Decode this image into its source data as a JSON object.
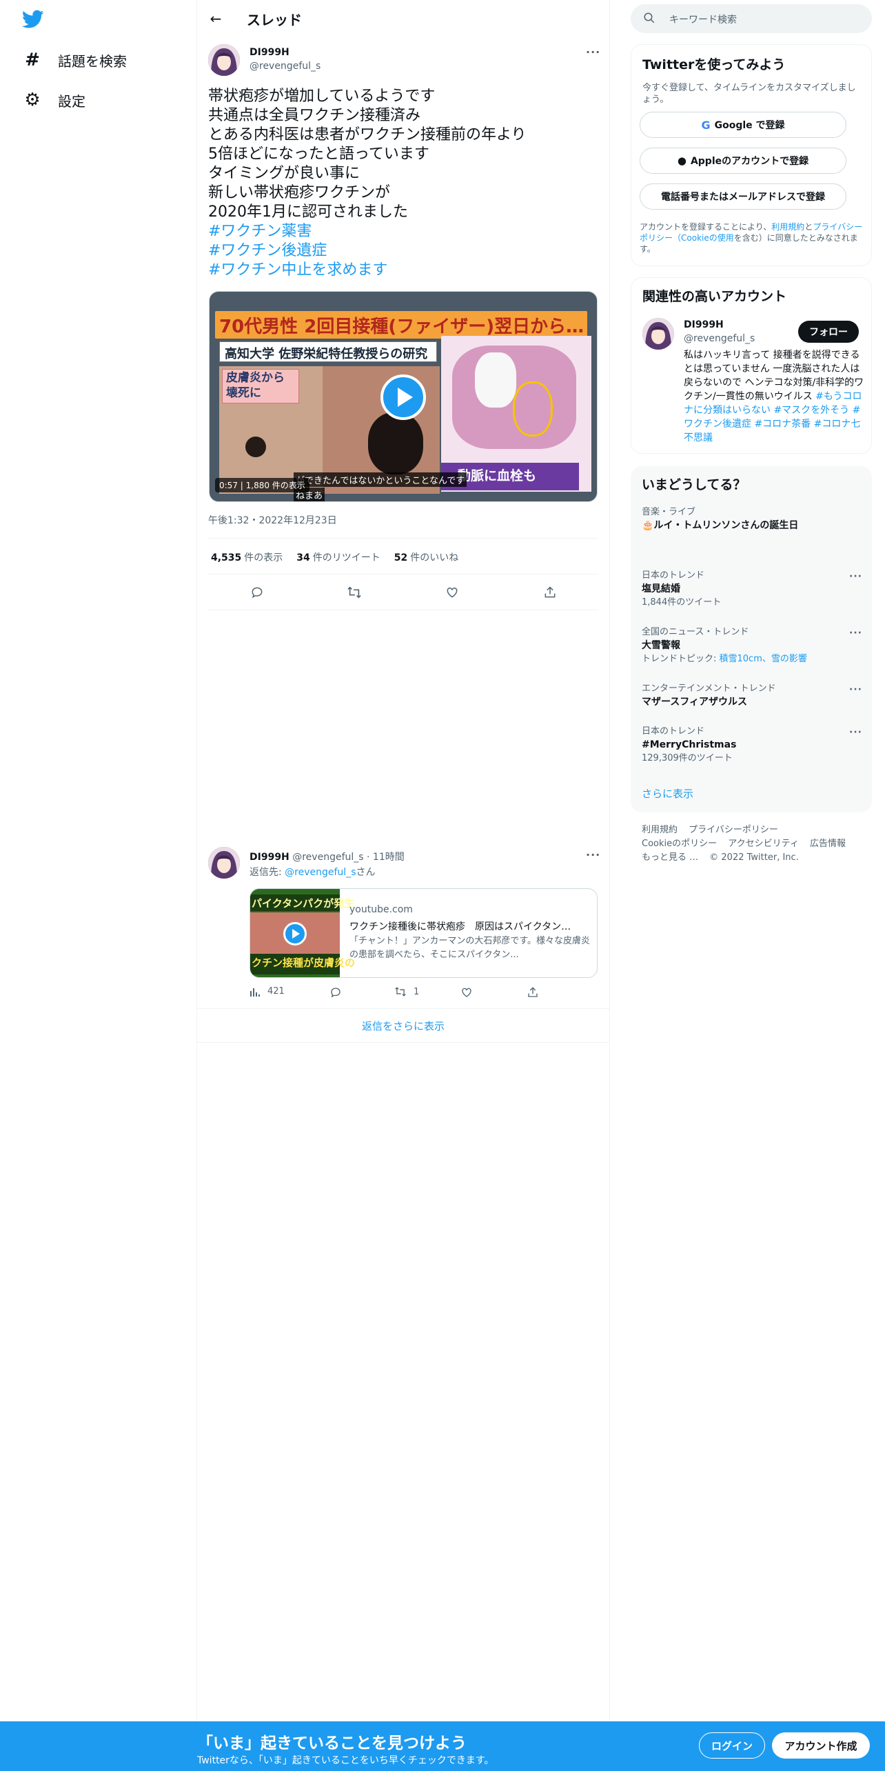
{
  "nav": {
    "logo": "twitter-bird",
    "items": [
      {
        "icon": "hashtag-icon",
        "glyph": "#",
        "label": "話題を検索"
      },
      {
        "icon": "gear-icon",
        "glyph": "⚙",
        "label": "設定"
      }
    ]
  },
  "header": {
    "title": "スレッド"
  },
  "tweet": {
    "author_name": "DI999H",
    "author_handle": "@revengeful_s",
    "text_lines": [
      "帯状疱疹が増加しているようです",
      "共通点は全員ワクチン接種済み",
      "とある内科医は患者がワクチン接種前の年より",
      "5倍ほどになったと語っています",
      "タイミングが良い事に",
      "新しい帯状疱疹ワクチンが",
      "2020年1月に認可されました"
    ],
    "hashtags": [
      "#ワクチン薬害",
      "#ワクチン後遺症",
      "#ワクチン中止を求めます"
    ],
    "media": {
      "banner": "70代男性 2回目接種(ファイザー)翌日から…",
      "subtitle": "高知大学 佐野栄紀特任教授らの研究",
      "callout": "皮膚炎から\n壊死に",
      "artery": "動脈に血栓も",
      "caption_line1": "ができたんではないかということなんです",
      "caption_line2": "ねまあ",
      "duration": "0:57",
      "views": "1,880 件の表示"
    },
    "timestamp": "午後1:32・2022年12月23日",
    "stats": {
      "views_num": "4,535",
      "views_label": "件の表示",
      "retweets_num": "34",
      "retweets_label": "件のリツイート",
      "likes_num": "52",
      "likes_label": "件のいいね"
    }
  },
  "reply": {
    "author_name": "DI999H",
    "author_handle": "@revengeful_s",
    "time": "11時間",
    "replying_to_prefix": "返信先:",
    "replying_to_mention": "@revengeful_s",
    "replying_to_suffix": "さん",
    "card": {
      "thumb_top": "パイクタンパクが発生",
      "thumb_bottom": "クチン接種が皮膚炎の",
      "domain": "youtube.com",
      "title": "ワクチン接種後に帯状疱疹　原因はスパイクタン…",
      "description": "「チャント！」アンカーマンの大石邦彦です。様々な皮膚炎の患部を調べたら、そこにスパイクタン..."
    },
    "views": "421",
    "retweets": "1",
    "show_more": "返信をさらに表示"
  },
  "right": {
    "search_placeholder": "キーワード検索",
    "signup": {
      "title": "Twitterを使ってみよう",
      "subtitle": "今すぐ登録して、タイムラインをカスタマイズしましょう。",
      "google": "Google で登録",
      "apple": "Appleのアカウントで登録",
      "phone": "電話番号またはメールアドレスで登録",
      "terms_a": "アカウントを登録することにより、",
      "terms_link1": "利用規約",
      "terms_b": "と",
      "terms_link2": "プライバシーポリシー（Cookieの使用",
      "terms_c": "を含む）に同意したとみなされます。"
    },
    "related": {
      "title": "関連性の高いアカウント",
      "name": "DI999H",
      "handle": "@revengeful_s",
      "follow": "フォロー",
      "bio_text": "私はハッキリ言って 接種者を説得できるとは思っていません 一度洗脳された人は戻らないので ヘンテコな対策/非科学的ワクチン/一貫性の無いウイルス ",
      "bio_tags": "#もうコロナに分類はいらない #マスクを外そう #ワクチン後遺症 #コロナ茶番 #コロナ七不思議"
    },
    "trends": {
      "title": "いまどうしてる？",
      "items": [
        {
          "context": "音楽・ライブ",
          "name": "🎂ルイ・トムリンソンさんの誕生日",
          "count": ""
        },
        {
          "context": "日本のトレンド",
          "name": "塩見結婚",
          "count": "1,844件のツイート"
        },
        {
          "context": "全国のニュース・トレンド",
          "name": "大雪警報",
          "count_prefix": "トレンドトピック: ",
          "count_link": "積雪10cm、雪の影響"
        },
        {
          "context": "エンターテインメント・トレンド",
          "name": "マザースフィアザウルス",
          "count": ""
        },
        {
          "context": "日本のトレンド",
          "name": "#MerryChristmas",
          "count": "129,309件のツイート"
        }
      ],
      "show_more": "さらに表示"
    },
    "footer": {
      "links": [
        "利用規約",
        "プライバシーポリシー",
        "Cookieのポリシー",
        "アクセシビリティ",
        "広告情報",
        "もっと見る …",
        "© 2022 Twitter, Inc."
      ]
    }
  },
  "bottombar": {
    "title": "「いま」起きていることを見つけよう",
    "subtitle": "Twitterなら、「いま」起きていることをいち早くチェックできます。",
    "login": "ログイン",
    "signup": "アカウント作成"
  },
  "colors": {
    "accent": "#1d9bf0",
    "text": "#0f1419",
    "secondary": "#536471"
  }
}
